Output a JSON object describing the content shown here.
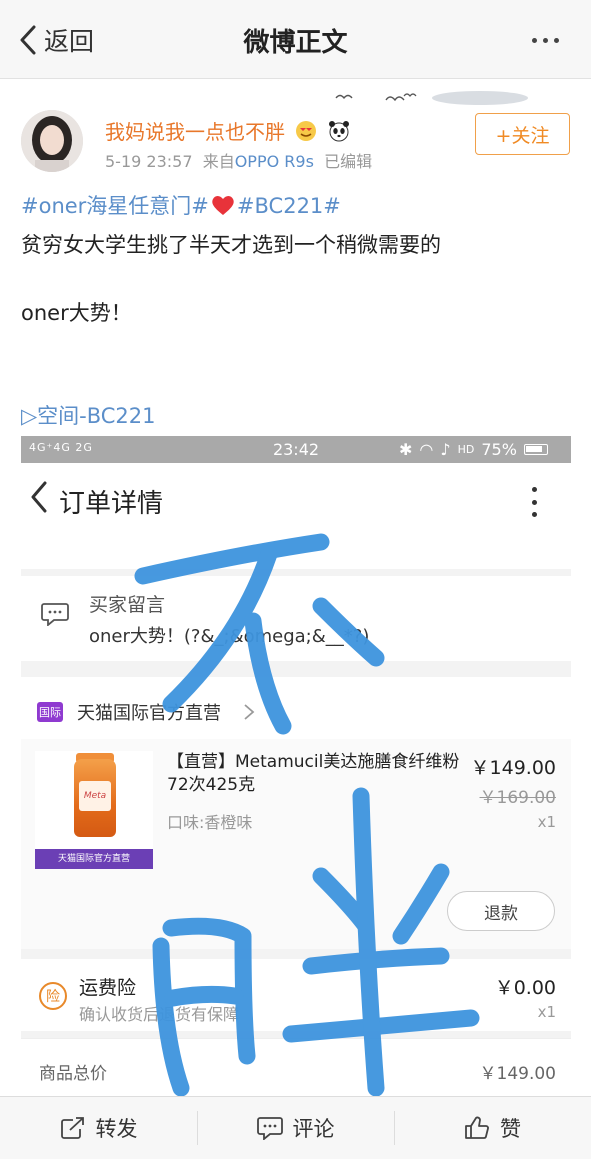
{
  "nav": {
    "back_label": "返回",
    "title": "微博正文"
  },
  "post": {
    "username": "我妈说我一点也不胖",
    "date": "5-19 23:57",
    "source_prefix": "来自",
    "source": "OPPO R9s",
    "edited": "已编辑",
    "follow_label": "+关注",
    "topics": "#oner海星任意门#",
    "topics2": "#BC221#",
    "line1": "贫穷女大学生挑了半天才选到一个稍微需要的",
    "line2": "oner大势！",
    "space_link": "▷空间-BC221"
  },
  "order_screenshot": {
    "status_bar": {
      "left": "4G⁺4G 2G",
      "time": "23:42",
      "battery": "75%"
    },
    "title": "订单详情",
    "message_label": "买家留言",
    "message_value": "oner大势！(?&_;&omega;&__*?)",
    "shop_name": "天猫国际官方直营",
    "shop_badge": "国际",
    "product": {
      "title": "【直营】Metamucil美达施膳食纤维粉72次425克",
      "flavor": "口味:香橙味",
      "price": "￥149.00",
      "old_price": "￥169.00",
      "qty": "x1",
      "banner": "天猫国际官方直营",
      "refund_label": "退款"
    },
    "shipping": {
      "badge": "险",
      "name": "运费险",
      "desc": "确认收货后退货有保障",
      "price": "￥0.00",
      "qty": "x1"
    },
    "total_label": "商品总价",
    "total_value": "￥149.00",
    "handwriting": "不胖"
  },
  "bottom_bar": {
    "repost": "转发",
    "comment": "评论",
    "like": "赞"
  },
  "colors": {
    "accent_orange": "#e8772a",
    "link_blue": "#5b8ec9",
    "scribble_blue": "#3e94de"
  }
}
